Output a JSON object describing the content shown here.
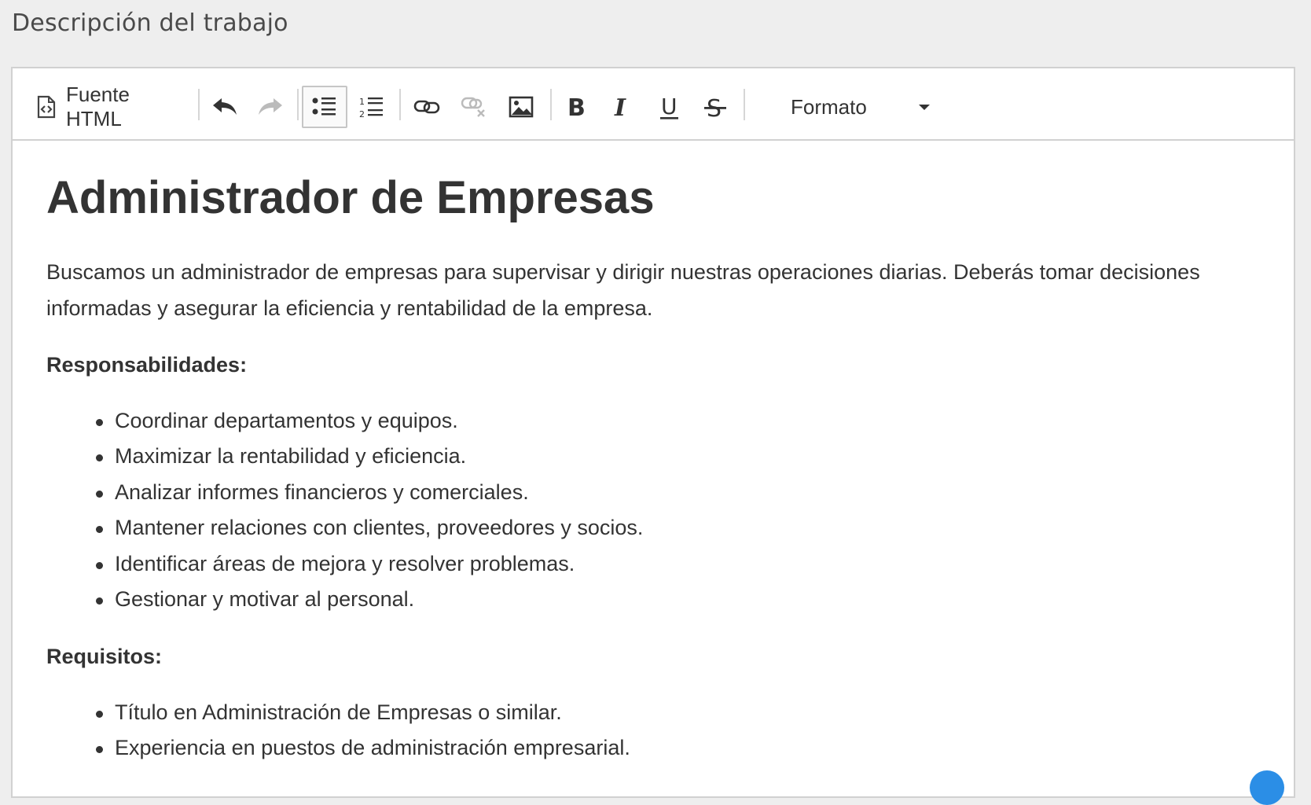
{
  "field": {
    "label": "Descripción del trabajo"
  },
  "toolbar": {
    "source_label": "Fuente HTML",
    "format_label": "Formato",
    "icons": {
      "source": "html-source-icon",
      "undo": "undo-icon",
      "redo": "redo-icon",
      "bullet_list": "bulleted-list-icon",
      "numbered_list": "numbered-list-icon",
      "link": "link-icon",
      "unlink": "unlink-icon",
      "image": "image-icon",
      "bold": "bold-icon",
      "italic": "italic-icon",
      "underline": "underline-icon",
      "strike": "strikethrough-icon"
    },
    "bold_glyph": "B",
    "italic_glyph": "I",
    "underline_glyph": "U",
    "strike_glyph": "S"
  },
  "content": {
    "title": "Administrador de Empresas",
    "intro": "Buscamos un administrador de empresas para supervisar y dirigir nuestras operaciones diarias. Deberás tomar decisiones informadas y asegurar la eficiencia y rentabilidad de la empresa.",
    "responsibilities_heading": "Responsabilidades:",
    "responsibilities": [
      "Coordinar departamentos y equipos.",
      "Maximizar la rentabilidad y eficiencia.",
      "Analizar informes financieros y comerciales.",
      "Mantener relaciones con clientes, proveedores y socios.",
      "Identificar áreas de mejora y resolver problemas.",
      "Gestionar y motivar al personal."
    ],
    "requirements_heading": "Requisitos:",
    "requirements": [
      "Título en Administración de Empresas o similar.",
      "Experiencia en puestos de administración empresarial."
    ]
  },
  "colors": {
    "accent": "#2b8ee6",
    "text": "#333333",
    "background": "#eeeeee",
    "border": "#d1d1d1"
  }
}
